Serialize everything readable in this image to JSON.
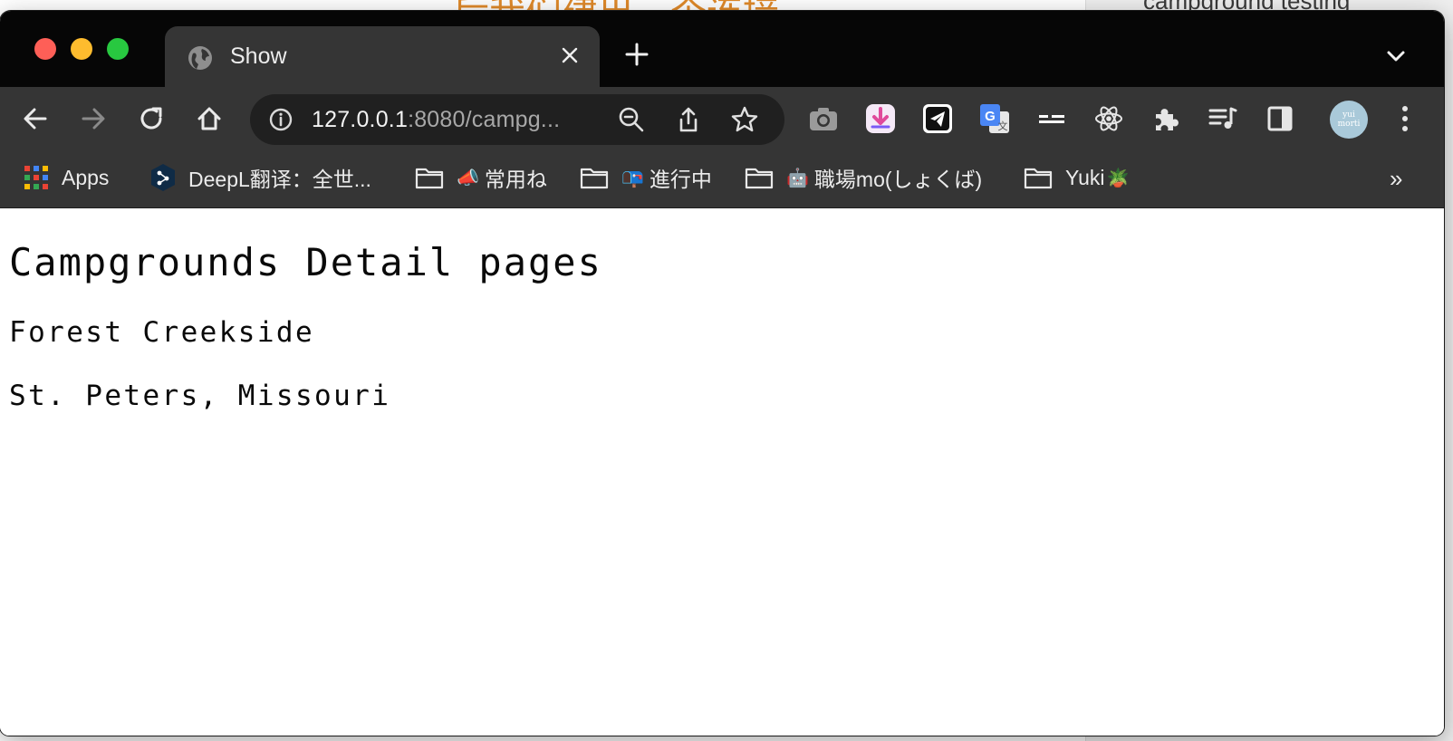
{
  "backdrop": {
    "left_text": "后我们建出一个连接。",
    "right_text": "campground testing"
  },
  "browser": {
    "tab": {
      "title": "Show",
      "favicon": "globe-icon"
    },
    "address": {
      "host": "127.0.0.1",
      "rest": ":8080/campg..."
    },
    "nav_icons": [
      "back-arrow-icon",
      "forward-arrow-icon",
      "reload-icon",
      "home-icon"
    ],
    "omnibox_icons": [
      "info-icon",
      "zoom-out-icon",
      "share-icon",
      "bookmark-star-icon"
    ],
    "extension_icons": [
      "camera-icon",
      "downloader-icon",
      "telegram-icon",
      "google-translate-icon",
      "dash-icon",
      "react-devtools-icon",
      "puzzle-extensions-icon",
      "reading-list-icon",
      "side-panel-icon"
    ],
    "profile": {
      "avatar_text_1": "yui",
      "avatar_text_2": "morti"
    }
  },
  "bookmarks": [
    {
      "label": "Apps",
      "icon": "apps-grid-icon"
    },
    {
      "label": "DeepL翻译：全世...",
      "icon": "deepl-icon"
    },
    {
      "label": "常用ね",
      "icon": "folder-icon",
      "emoji": "📣"
    },
    {
      "label": "進行中",
      "icon": "folder-icon",
      "emoji": "📭"
    },
    {
      "label": "職場mo(しょくば)",
      "icon": "folder-icon",
      "emoji": "🤖"
    },
    {
      "label": "Yuki",
      "icon": "folder-icon",
      "emoji_after": "🪴"
    }
  ],
  "bookmarks_overflow": "»",
  "page": {
    "heading": "Campgrounds Detail pages",
    "campground_name": "Forest Creekside",
    "campground_location": "St. Peters, Missouri"
  },
  "colors": {
    "titlebar": "#060606",
    "toolbar": "#353535",
    "omnibox": "#202020",
    "close": "#fe5f57",
    "minimize": "#febc2e",
    "zoom": "#28c840"
  }
}
